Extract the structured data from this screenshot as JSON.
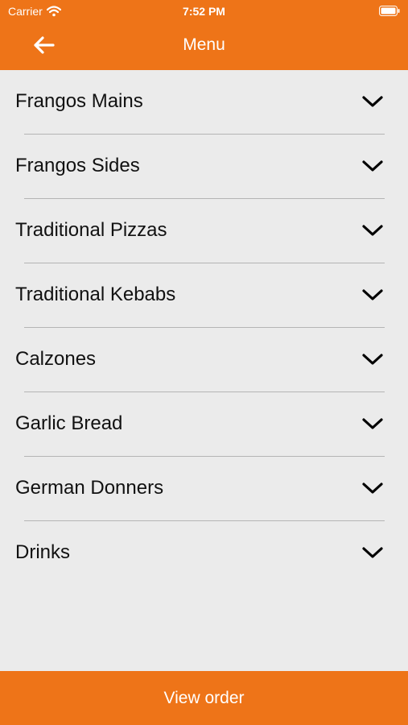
{
  "status_bar": {
    "carrier": "Carrier",
    "time": "7:52 PM",
    "wifi_icon": "wifi-icon",
    "battery_icon": "battery-icon"
  },
  "nav": {
    "title": "Menu",
    "back_icon": "arrow-left-icon"
  },
  "menu": {
    "items": [
      {
        "label": "Frangos Mains"
      },
      {
        "label": "Frangos Sides"
      },
      {
        "label": "Traditional Pizzas"
      },
      {
        "label": "Traditional Kebabs"
      },
      {
        "label": "Calzones"
      },
      {
        "label": "Garlic Bread"
      },
      {
        "label": "German Donners"
      },
      {
        "label": "Drinks"
      }
    ],
    "expand_icon": "chevron-down-icon"
  },
  "footer": {
    "view_order_label": "View order"
  },
  "colors": {
    "accent": "#ee7418",
    "background": "#ebebeb",
    "divider": "#b4b4b4",
    "text": "#111111"
  }
}
